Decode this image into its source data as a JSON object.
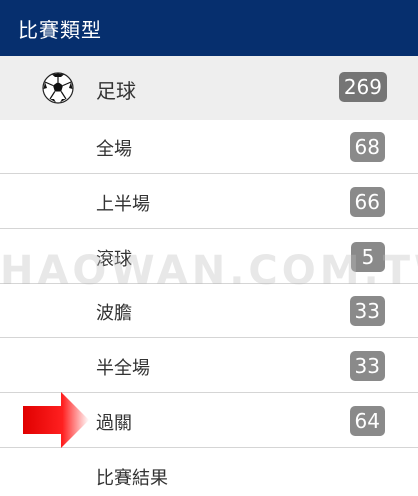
{
  "header": {
    "title": "比賽類型"
  },
  "sport": {
    "label": "足球",
    "count": "269",
    "icon": "soccer-ball-icon"
  },
  "items": [
    {
      "label": "全場",
      "count": "68"
    },
    {
      "label": "上半場",
      "count": "66"
    },
    {
      "label": "滾球",
      "count": "5"
    },
    {
      "label": "波膽",
      "count": "33"
    },
    {
      "label": "半全場",
      "count": "33"
    },
    {
      "label": "過關",
      "count": "64"
    },
    {
      "label": "比賽結果",
      "count": ""
    }
  ],
  "watermark": "HAOWAN.COM.TW",
  "colors": {
    "header_bg": "#062f6e",
    "badge_bg": "#8a8a8a",
    "arrow": "#e00000"
  }
}
